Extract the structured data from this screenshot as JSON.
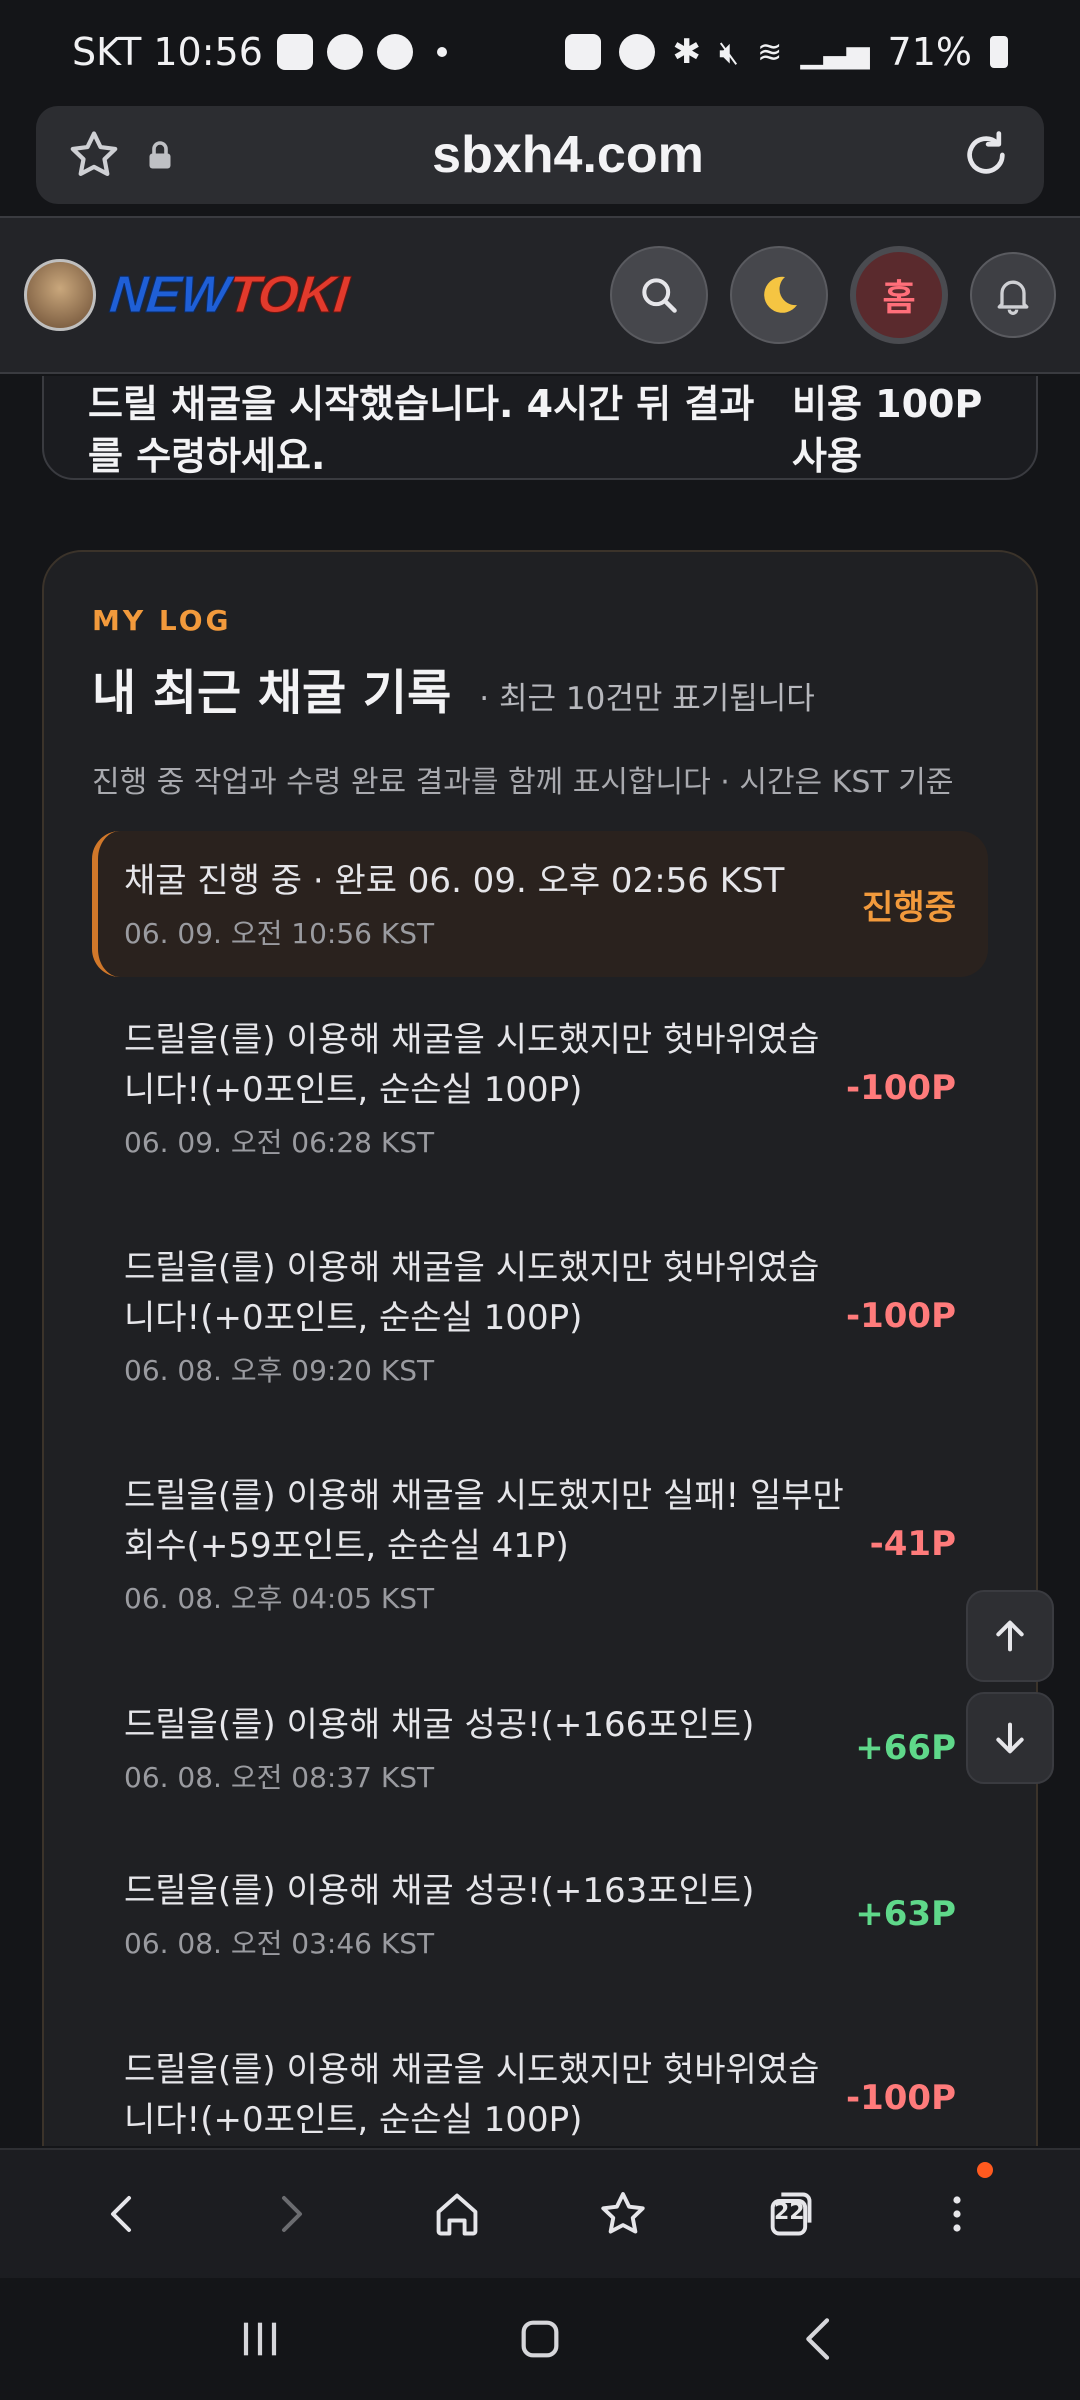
{
  "status_bar": {
    "carrier_time": "SKT 10:56",
    "battery": "71%"
  },
  "browser": {
    "url": "sbxh4.com"
  },
  "site_header": {
    "logo_part1": "NEW",
    "logo_part2": "TOKI",
    "home_label": "홈"
  },
  "top_card": {
    "message": "드릴 채굴을 시작했습니다. 4시간 뒤 결과를 수령하세요.",
    "cost": "비용 100P 사용"
  },
  "log": {
    "eyebrow": "MY LOG",
    "title": "내 최근 채굴 기록",
    "title_note": "· 최근 10건만 표기됩니다",
    "description": "진행 중 작업과 수령 완료 결과를 함께 표시합니다 · 시간은 KST 기준",
    "entries": [
      {
        "text": "채굴 진행 중 · 완료 06. 09. 오후 02:56 KST",
        "time": "06. 09. 오전 10:56 KST",
        "amount": "진행중"
      },
      {
        "text": "드릴을(를) 이용해 채굴을 시도했지만 헛바위였습니다!(+0포인트, 순손실 100P)",
        "time": "06. 09. 오전 06:28 KST",
        "amount": "-100P"
      },
      {
        "text": "드릴을(를) 이용해 채굴을 시도했지만 헛바위였습니다!(+0포인트, 순손실 100P)",
        "time": "06. 08. 오후 09:20 KST",
        "amount": "-100P"
      },
      {
        "text": "드릴을(를) 이용해 채굴을 시도했지만 실패! 일부만 회수(+59포인트, 순손실 41P)",
        "time": "06. 08. 오후 04:05 KST",
        "amount": "-41P"
      },
      {
        "text": "드릴을(를) 이용해 채굴 성공!(+166포인트)",
        "time": "06. 08. 오전 08:37 KST",
        "amount": "+66P"
      },
      {
        "text": "드릴을(를) 이용해 채굴 성공!(+163포인트)",
        "time": "06. 08. 오전 03:46 KST",
        "amount": "+63P"
      },
      {
        "text": "드릴을(를) 이용해 채굴을 시도했지만 헛바위였습니다!(+0포인트, 순손실 100P)",
        "time": "",
        "amount": "-100P"
      }
    ]
  },
  "bottom_bar": {
    "tab_count": "22"
  },
  "colors": {
    "accent_orange": "#f29a3c",
    "loss_red": "#ff7b7b",
    "gain_green": "#5fd88a"
  },
  "icons": [
    "star-icon",
    "lock-icon",
    "reload-icon",
    "search-icon",
    "moon-icon",
    "bell-icon",
    "arrow-up-icon",
    "arrow-down-icon",
    "back-icon",
    "forward-icon",
    "home-icon",
    "bookmarks-icon",
    "tabs-icon",
    "menu-icon"
  ]
}
